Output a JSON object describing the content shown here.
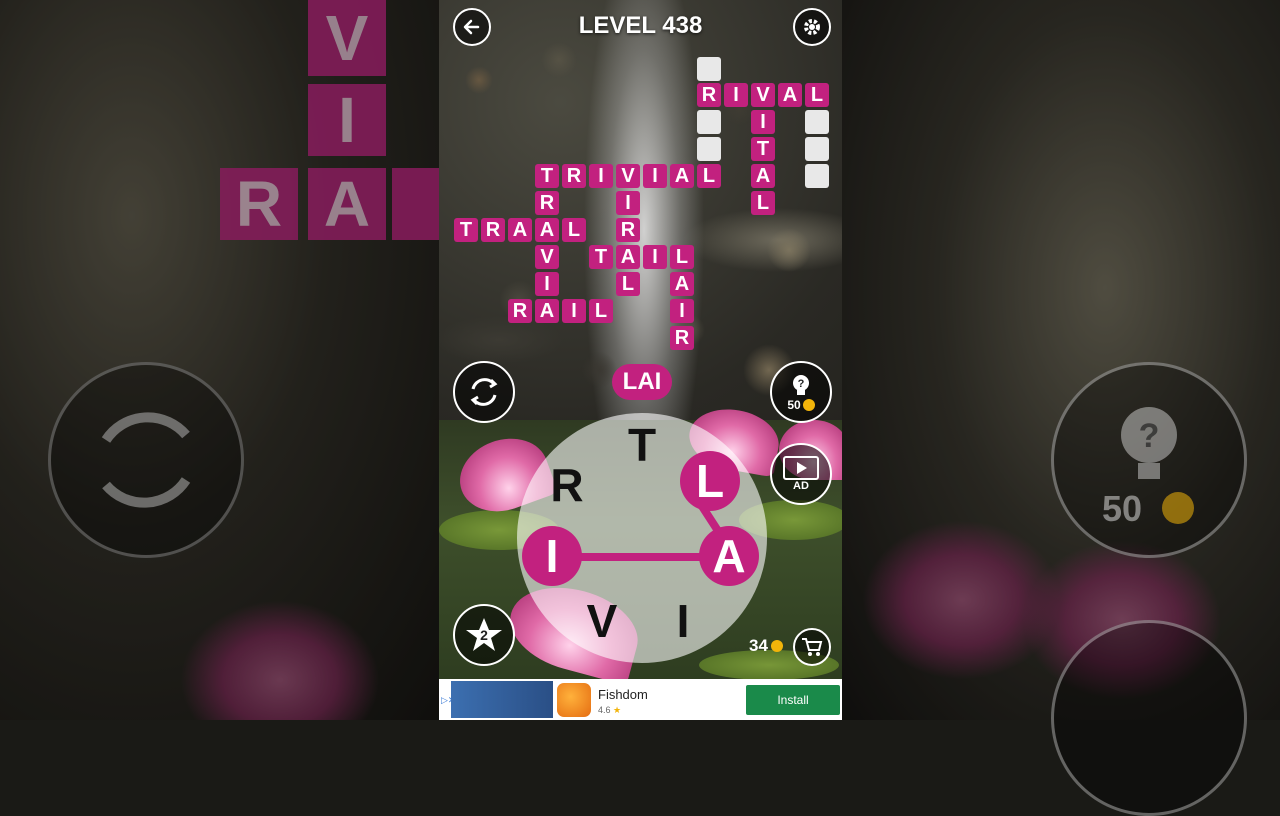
{
  "level_title": "LEVEL 438",
  "side_tiles_left": [
    "V",
    "I",
    "R",
    "A"
  ],
  "side_coins": "50",
  "grid": {
    "words": [
      {
        "text": "RIVAL"
      },
      {
        "text": "VITAL"
      },
      {
        "text": "TRIVIAL"
      },
      {
        "text": "TRAIL"
      },
      {
        "text": "VIRAL"
      },
      {
        "text": "TAIL"
      },
      {
        "text": "LAIR"
      },
      {
        "text": "RAIL"
      }
    ]
  },
  "preview_word": "LAI",
  "wheel_letters": [
    "T",
    "L",
    "A",
    "I",
    "V",
    "R"
  ],
  "buttons": {
    "hint_cost": "50",
    "ad_label": "AD",
    "star_count": "2",
    "coins": "34"
  },
  "ad": {
    "app_name": "Fishdom",
    "rating": "4.6",
    "install_label": "Install"
  },
  "colors": {
    "tile": "#c2217f",
    "accent": "#c2217f"
  }
}
